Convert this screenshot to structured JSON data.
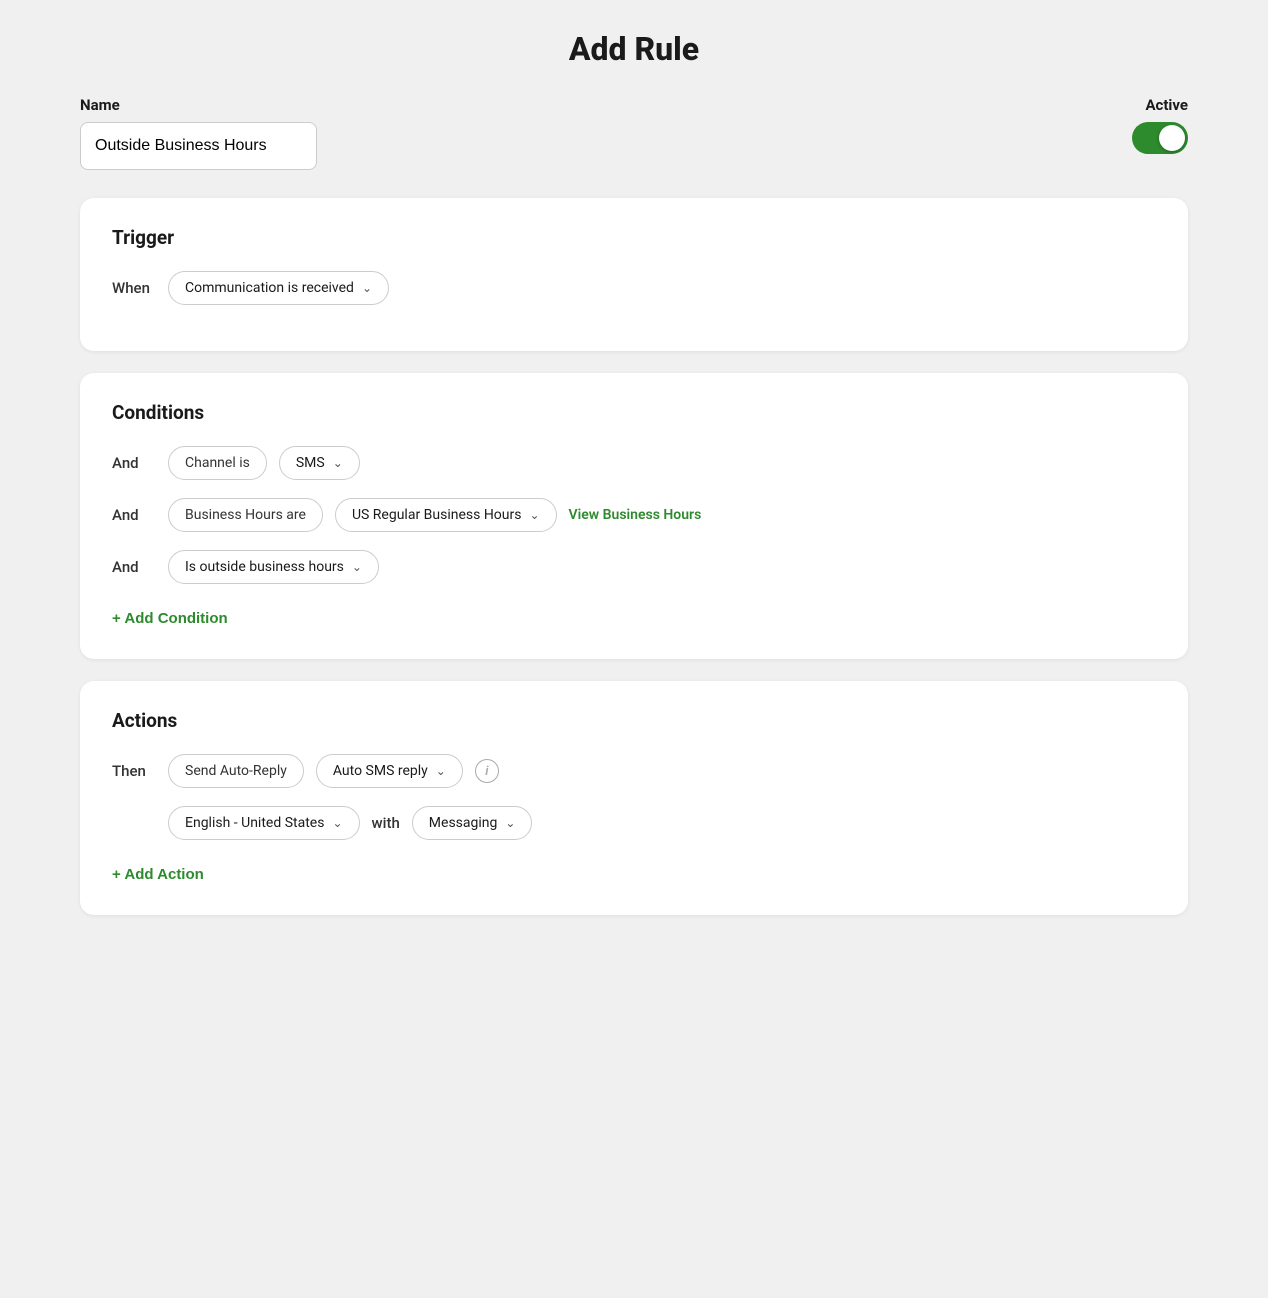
{
  "page": {
    "title": "Add Rule"
  },
  "header": {
    "name_label": "Name",
    "active_label": "Active",
    "name_value": "Outside Business Hours",
    "toggle_on": true
  },
  "trigger": {
    "section_title": "Trigger",
    "when_label": "When",
    "trigger_value": "Communication is received"
  },
  "conditions": {
    "section_title": "Conditions",
    "rows": [
      {
        "label": "And",
        "pill_static": "Channel is",
        "pill_dropdown": "SMS"
      },
      {
        "label": "And",
        "pill_static": "Business Hours are",
        "pill_dropdown": "US Regular Business Hours",
        "link": "View Business Hours"
      },
      {
        "label": "And",
        "pill_dropdown": "Is outside business hours"
      }
    ],
    "add_condition_label": "+ Add Condition"
  },
  "actions": {
    "section_title": "Actions",
    "then_label": "Then",
    "send_pill": "Send Auto-Reply",
    "type_dropdown": "Auto SMS reply",
    "lang_dropdown": "English - United States",
    "with_label": "with",
    "channel_dropdown": "Messaging",
    "add_action_label": "+ Add Action"
  },
  "icons": {
    "chevron": "⌄",
    "info": "i",
    "plus": "+"
  }
}
